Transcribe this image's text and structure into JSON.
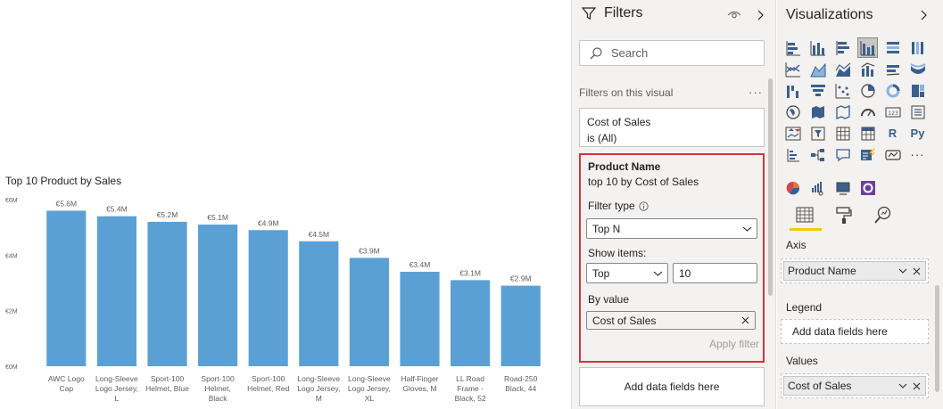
{
  "chart_data": {
    "type": "bar",
    "title": "Top 10 Product by Sales",
    "categories": [
      [
        "AWC Logo",
        "Cap"
      ],
      [
        "Long-Sleeve",
        "Logo Jersey,",
        "L"
      ],
      [
        "Sport-100",
        "Helmet, Blue"
      ],
      [
        "Sport-100",
        "Helmet,",
        "Black"
      ],
      [
        "Sport-100",
        "Helmet, Red"
      ],
      [
        "Long-Sleeve",
        "Logo Jersey,",
        "M"
      ],
      [
        "Long-Sleeve",
        "Logo Jersey,",
        "XL"
      ],
      [
        "Half-Finger",
        "Gloves, M"
      ],
      [
        "LL Road",
        "Frame -",
        "Black, 52"
      ],
      [
        "Road-250",
        "Black, 44"
      ]
    ],
    "values": [
      5.6,
      5.4,
      5.2,
      5.1,
      4.9,
      4.5,
      3.9,
      3.4,
      3.1,
      2.9
    ],
    "data_labels": [
      "€5.6M",
      "€5.4M",
      "€5.2M",
      "€5.1M",
      "€4.9M",
      "€4.5M",
      "€3.9M",
      "€3.4M",
      "€3.1M",
      "€2.9M"
    ],
    "y_ticks": [
      0,
      2,
      4,
      6
    ],
    "y_tick_labels": [
      "€0M",
      "€2M",
      "€4M",
      "€6M"
    ],
    "ylim": [
      0,
      6
    ],
    "bar_color": "#5aa0d5",
    "grid": false,
    "legend": "none"
  },
  "filters": {
    "title": "Filters",
    "search_placeholder": "Search",
    "section_label": "Filters on this visual",
    "more": "···",
    "cost_card": {
      "title": "Cost of Sales",
      "state": "is (All)"
    },
    "product_card": {
      "title": "Product Name",
      "summary": "top 10 by Cost of Sales",
      "filter_type_label": "Filter type",
      "filter_type_value": "Top N",
      "show_items_label": "Show items:",
      "show_items_direction": "Top",
      "show_items_count": "10",
      "by_value_label": "By value",
      "by_value_field": "Cost of Sales",
      "apply_label": "Apply filter"
    },
    "add_fields": "Add data fields here",
    "highlight_color": "#d13438"
  },
  "visualizations": {
    "title": "Visualizations",
    "axis_label": "Axis",
    "axis_field": "Product Name",
    "legend_label": "Legend",
    "legend_placeholder": "Add data fields here",
    "values_label": "Values",
    "values_field": "Cost of Sales",
    "r_icon": "R",
    "py_icon": "Py",
    "more": "···",
    "accent_color": "#f2c811"
  }
}
